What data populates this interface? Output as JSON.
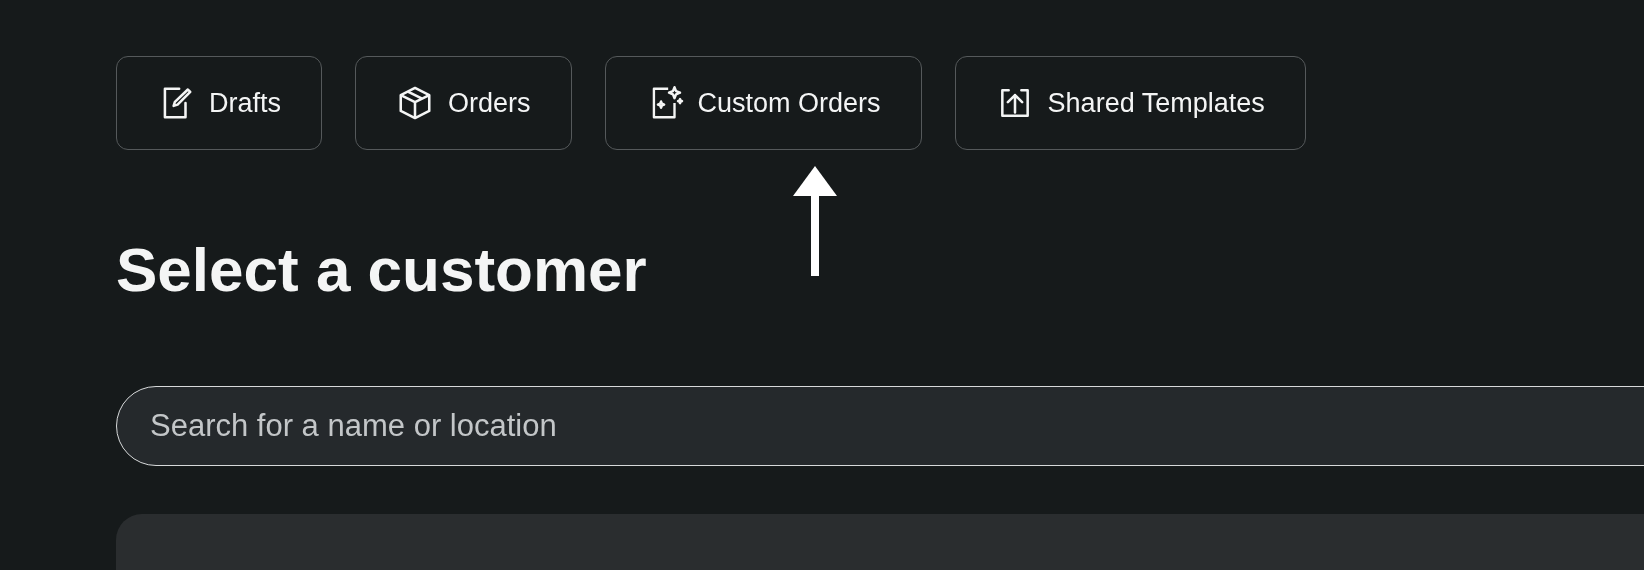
{
  "nav_buttons": [
    {
      "label": "Drafts"
    },
    {
      "label": "Orders"
    },
    {
      "label": "Custom Orders"
    },
    {
      "label": "Shared Templates"
    }
  ],
  "heading": "Select a customer",
  "search": {
    "placeholder": "Search for a name or location"
  }
}
